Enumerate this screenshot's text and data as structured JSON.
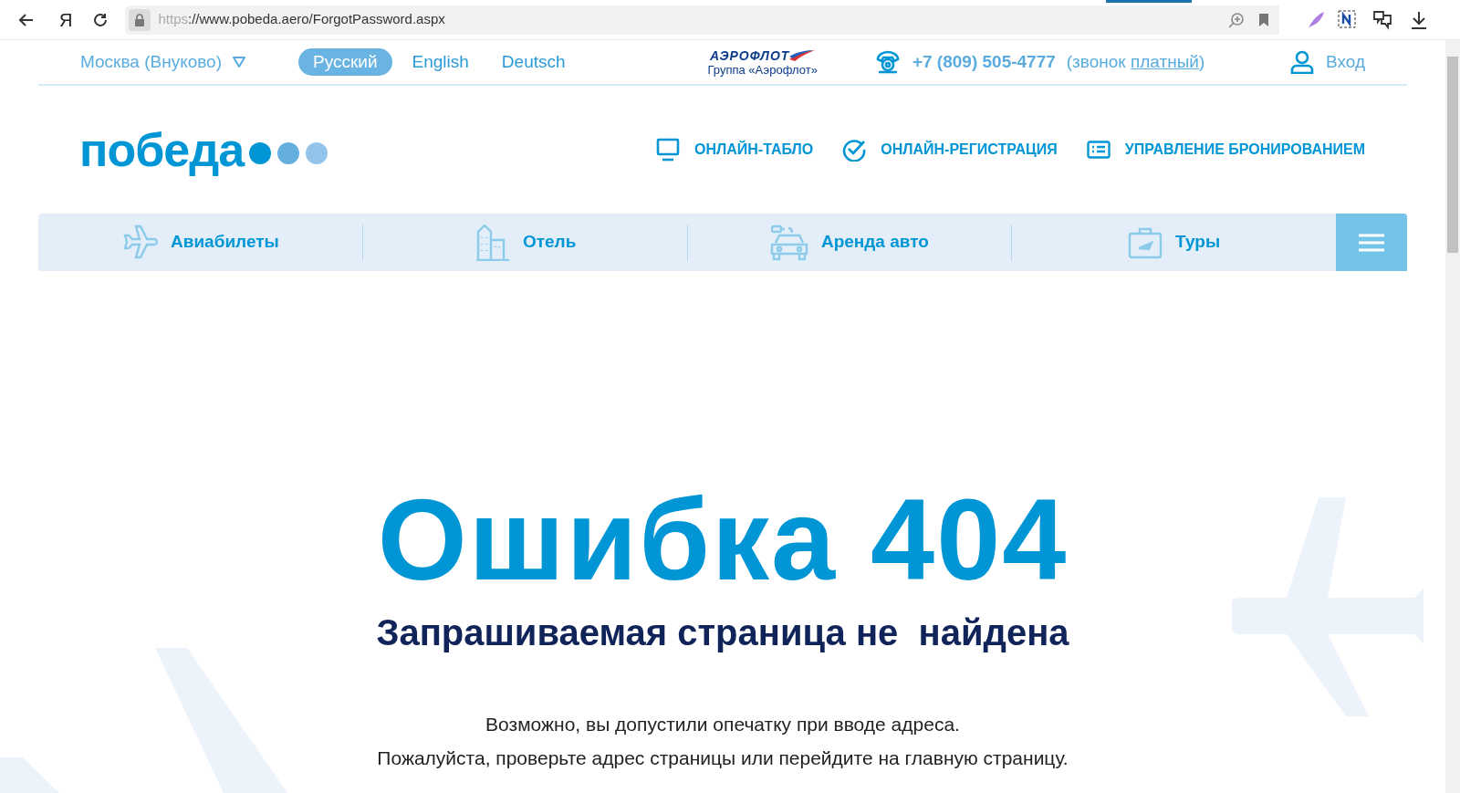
{
  "browser": {
    "brand_glyph": "Я",
    "url_scheme": "https",
    "url_rest": "://www.pobeda.aero/ForgotPassword.aspx"
  },
  "topbar": {
    "city": "Москва (Внуково)",
    "languages": [
      {
        "label": "Русский",
        "selected": true
      },
      {
        "label": "English",
        "selected": false
      },
      {
        "label": "Deutsch",
        "selected": false
      }
    ],
    "partner_name": "АЭРОФЛОТ",
    "partner_group": "Группа «Аэрофлот»",
    "phone": "+7 (809) 505-4777",
    "call_note_prefix": "(звонок ",
    "call_note_link": "платный",
    "call_note_suffix": ")",
    "login": "Вход"
  },
  "header": {
    "logo": "победа",
    "links": [
      {
        "kind": "monitor",
        "label": "ОНЛАЙН-ТАБЛО"
      },
      {
        "kind": "check",
        "label": "ОНЛАЙН-РЕГИСТРАЦИЯ"
      },
      {
        "kind": "card",
        "label": "УПРАВЛЕНИЕ БРОНИРОВАНИЕМ"
      }
    ]
  },
  "nav": [
    {
      "kind": "plane",
      "label": "Авиабилеты"
    },
    {
      "kind": "hotel",
      "label": "Отель"
    },
    {
      "kind": "car",
      "label": "Аренда авто"
    },
    {
      "kind": "tour",
      "label": "Туры"
    }
  ],
  "error": {
    "title": "Ошибка 404",
    "subtitle": "Запрашиваемая страница не  найдена",
    "lines": [
      "Возможно, вы допустили опечатку при вводе адреса.",
      "Пожалуйста, проверьте адрес страницы или перейдите на главную страницу."
    ]
  }
}
